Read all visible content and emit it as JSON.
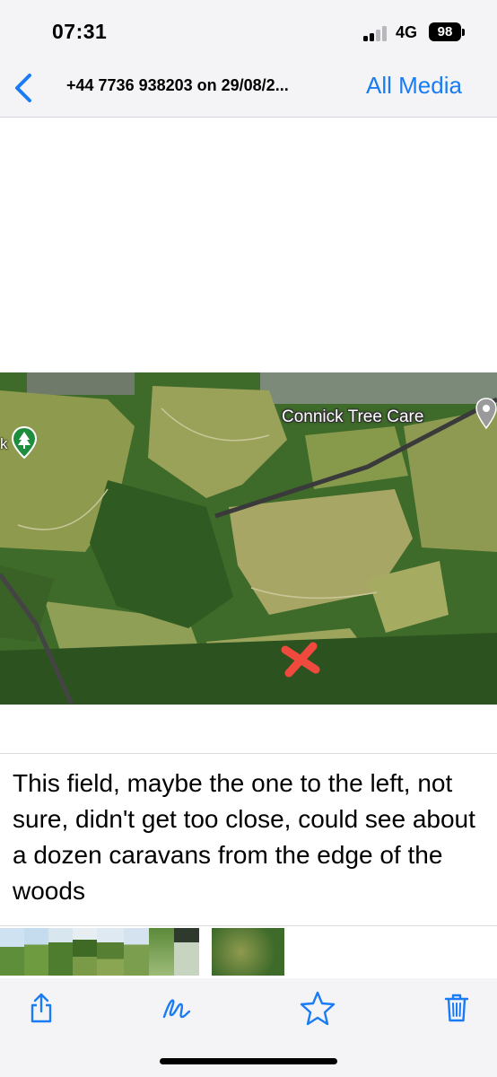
{
  "status_bar": {
    "time": "07:31",
    "network": "4G",
    "battery": "98"
  },
  "nav": {
    "title": "+44 7736 938203 on 29/08/2...",
    "all_media": "All Media"
  },
  "image": {
    "place_label": "Connick Tree Care",
    "partial_label": "k"
  },
  "caption": "This field, maybe the one to the left, not sure, didn't get too close, could see about a dozen caravans from the edge of the woods",
  "colors": {
    "accent": "#1a7cf5",
    "marker": "#f04a3e",
    "park_pin": "#1e8e3e"
  },
  "toolbar_icons": [
    "share-icon",
    "markup-icon",
    "favorite-star-icon",
    "trash-icon"
  ]
}
